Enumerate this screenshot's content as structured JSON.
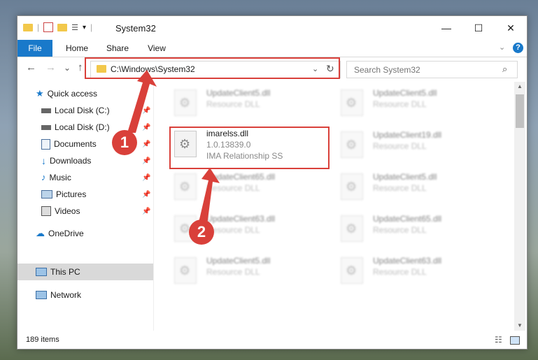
{
  "window": {
    "title": "System32",
    "controls": {
      "minimize": "—",
      "maximize": "☐",
      "close": "✕"
    }
  },
  "ribbon": {
    "tabs": [
      "File",
      "Home",
      "Share",
      "View"
    ],
    "help": "?"
  },
  "address": {
    "path": "C:\\Windows\\System32",
    "refresh": "↻"
  },
  "search": {
    "placeholder": "Search System32",
    "icon": "search-icon"
  },
  "nav": {
    "back": "←",
    "forward": "→",
    "recent": "⌄",
    "up": "↑"
  },
  "sidebar": {
    "items": [
      {
        "label": "Quick access",
        "icon": "star-icon"
      },
      {
        "label": "Local Disk (C:)",
        "icon": "drive-icon"
      },
      {
        "label": "Local Disk (D:)",
        "icon": "drive-icon"
      },
      {
        "label": "Documents",
        "icon": "documents-icon"
      },
      {
        "label": "Downloads",
        "icon": "downloads-icon"
      },
      {
        "label": "Music",
        "icon": "music-icon"
      },
      {
        "label": "Pictures",
        "icon": "pictures-icon"
      },
      {
        "label": "Videos",
        "icon": "videos-icon"
      },
      {
        "label": "OneDrive",
        "icon": "cloud-icon"
      },
      {
        "label": "This PC",
        "icon": "computer-icon"
      },
      {
        "label": "Network",
        "icon": "network-icon"
      }
    ]
  },
  "files": {
    "left": [
      {
        "name": "UpdateClient5.dll",
        "type": "Resource DLL"
      },
      {
        "name": "imarelss.dll",
        "type": "1.0.13839.0",
        "desc": "IMA Relationship SS"
      },
      {
        "name": "UpdateClient65.dll",
        "type": "Resource DLL"
      },
      {
        "name": "UpdateClient63.dll",
        "type": "Resource DLL"
      },
      {
        "name": "UpdateClient5.dll",
        "type": "Resource DLL"
      }
    ],
    "right": [
      {
        "name": "UpdateClient5.dll",
        "type": "Resource DLL"
      },
      {
        "name": "UpdateClient19.dll",
        "type": "Resource DLL"
      },
      {
        "name": "UpdateClient5.dll",
        "type": "Resource DLL"
      },
      {
        "name": "UpdateClient65.dll",
        "type": "Resource DLL"
      },
      {
        "name": "UpdateClient63.dll",
        "type": "Resource DLL"
      }
    ]
  },
  "status": {
    "count": "189 items"
  },
  "annotations": {
    "step1": "1",
    "step2": "2"
  },
  "colors": {
    "accent": "#1979ca",
    "highlight": "#d9403a",
    "selected": "#cce8ff"
  }
}
